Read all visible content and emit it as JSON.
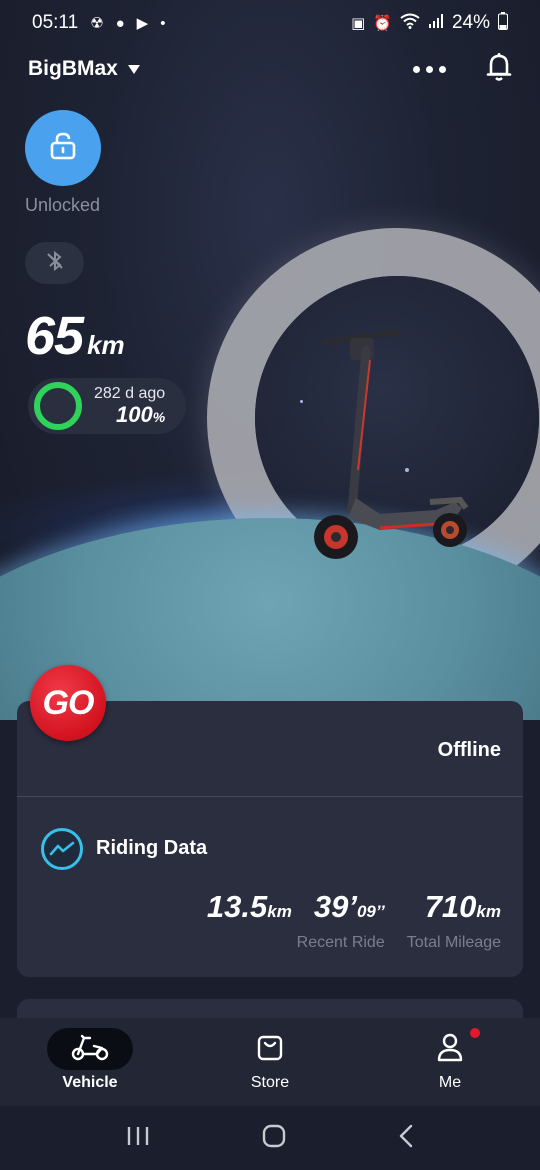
{
  "status_bar": {
    "time": "05:11",
    "battery": "24%",
    "left_icons": [
      "nfc-icon",
      "chat-icon",
      "youtube-icon",
      "dot-icon"
    ],
    "right_icons": [
      "battery-saver-icon",
      "alarm-icon",
      "wifi-icon",
      "signal-icon",
      "battery-icon"
    ]
  },
  "header": {
    "device_name": "BigBMax"
  },
  "lock": {
    "label": "Unlocked"
  },
  "range": {
    "value": "65",
    "unit": "km"
  },
  "battery": {
    "updated": "282 d ago",
    "percent": "100",
    "percent_unit": "%",
    "level": 1.0,
    "color": "#2fd35a"
  },
  "go_badge": {
    "label": "GO"
  },
  "connection": {
    "status": "Offline"
  },
  "riding_data": {
    "title": "Riding Data",
    "recent_distance": "13.5",
    "recent_distance_unit": "km",
    "recent_time_min": "39’",
    "recent_time_sec": "09’’",
    "recent_label": "Recent Ride",
    "total_mileage": "710",
    "total_mileage_unit": "km",
    "total_label": "Total Mileage"
  },
  "bottom_nav": {
    "items": [
      {
        "label": "Vehicle",
        "icon": "scooter-icon",
        "active": true
      },
      {
        "label": "Store",
        "icon": "bag-icon",
        "active": false
      },
      {
        "label": "Me",
        "icon": "person-icon",
        "active": false,
        "badge": true
      }
    ]
  },
  "colors": {
    "accent_blue": "#4aa2ee",
    "go_red": "#d3121f",
    "battery_green": "#2fd35a",
    "card_bg": "#2a2e3e"
  }
}
